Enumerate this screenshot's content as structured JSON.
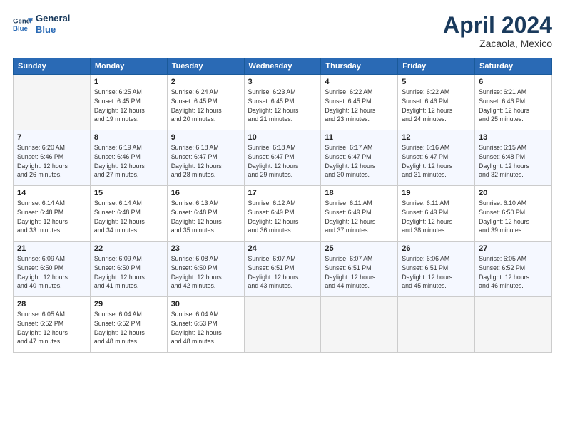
{
  "header": {
    "logo_line1": "General",
    "logo_line2": "Blue",
    "title": "April 2024",
    "subtitle": "Zacaola, Mexico"
  },
  "weekdays": [
    "Sunday",
    "Monday",
    "Tuesday",
    "Wednesday",
    "Thursday",
    "Friday",
    "Saturday"
  ],
  "weeks": [
    [
      {
        "num": "",
        "info": ""
      },
      {
        "num": "1",
        "info": "Sunrise: 6:25 AM\nSunset: 6:45 PM\nDaylight: 12 hours\nand 19 minutes."
      },
      {
        "num": "2",
        "info": "Sunrise: 6:24 AM\nSunset: 6:45 PM\nDaylight: 12 hours\nand 20 minutes."
      },
      {
        "num": "3",
        "info": "Sunrise: 6:23 AM\nSunset: 6:45 PM\nDaylight: 12 hours\nand 21 minutes."
      },
      {
        "num": "4",
        "info": "Sunrise: 6:22 AM\nSunset: 6:45 PM\nDaylight: 12 hours\nand 23 minutes."
      },
      {
        "num": "5",
        "info": "Sunrise: 6:22 AM\nSunset: 6:46 PM\nDaylight: 12 hours\nand 24 minutes."
      },
      {
        "num": "6",
        "info": "Sunrise: 6:21 AM\nSunset: 6:46 PM\nDaylight: 12 hours\nand 25 minutes."
      }
    ],
    [
      {
        "num": "7",
        "info": "Sunrise: 6:20 AM\nSunset: 6:46 PM\nDaylight: 12 hours\nand 26 minutes."
      },
      {
        "num": "8",
        "info": "Sunrise: 6:19 AM\nSunset: 6:46 PM\nDaylight: 12 hours\nand 27 minutes."
      },
      {
        "num": "9",
        "info": "Sunrise: 6:18 AM\nSunset: 6:47 PM\nDaylight: 12 hours\nand 28 minutes."
      },
      {
        "num": "10",
        "info": "Sunrise: 6:18 AM\nSunset: 6:47 PM\nDaylight: 12 hours\nand 29 minutes."
      },
      {
        "num": "11",
        "info": "Sunrise: 6:17 AM\nSunset: 6:47 PM\nDaylight: 12 hours\nand 30 minutes."
      },
      {
        "num": "12",
        "info": "Sunrise: 6:16 AM\nSunset: 6:47 PM\nDaylight: 12 hours\nand 31 minutes."
      },
      {
        "num": "13",
        "info": "Sunrise: 6:15 AM\nSunset: 6:48 PM\nDaylight: 12 hours\nand 32 minutes."
      }
    ],
    [
      {
        "num": "14",
        "info": "Sunrise: 6:14 AM\nSunset: 6:48 PM\nDaylight: 12 hours\nand 33 minutes."
      },
      {
        "num": "15",
        "info": "Sunrise: 6:14 AM\nSunset: 6:48 PM\nDaylight: 12 hours\nand 34 minutes."
      },
      {
        "num": "16",
        "info": "Sunrise: 6:13 AM\nSunset: 6:48 PM\nDaylight: 12 hours\nand 35 minutes."
      },
      {
        "num": "17",
        "info": "Sunrise: 6:12 AM\nSunset: 6:49 PM\nDaylight: 12 hours\nand 36 minutes."
      },
      {
        "num": "18",
        "info": "Sunrise: 6:11 AM\nSunset: 6:49 PM\nDaylight: 12 hours\nand 37 minutes."
      },
      {
        "num": "19",
        "info": "Sunrise: 6:11 AM\nSunset: 6:49 PM\nDaylight: 12 hours\nand 38 minutes."
      },
      {
        "num": "20",
        "info": "Sunrise: 6:10 AM\nSunset: 6:50 PM\nDaylight: 12 hours\nand 39 minutes."
      }
    ],
    [
      {
        "num": "21",
        "info": "Sunrise: 6:09 AM\nSunset: 6:50 PM\nDaylight: 12 hours\nand 40 minutes."
      },
      {
        "num": "22",
        "info": "Sunrise: 6:09 AM\nSunset: 6:50 PM\nDaylight: 12 hours\nand 41 minutes."
      },
      {
        "num": "23",
        "info": "Sunrise: 6:08 AM\nSunset: 6:50 PM\nDaylight: 12 hours\nand 42 minutes."
      },
      {
        "num": "24",
        "info": "Sunrise: 6:07 AM\nSunset: 6:51 PM\nDaylight: 12 hours\nand 43 minutes."
      },
      {
        "num": "25",
        "info": "Sunrise: 6:07 AM\nSunset: 6:51 PM\nDaylight: 12 hours\nand 44 minutes."
      },
      {
        "num": "26",
        "info": "Sunrise: 6:06 AM\nSunset: 6:51 PM\nDaylight: 12 hours\nand 45 minutes."
      },
      {
        "num": "27",
        "info": "Sunrise: 6:05 AM\nSunset: 6:52 PM\nDaylight: 12 hours\nand 46 minutes."
      }
    ],
    [
      {
        "num": "28",
        "info": "Sunrise: 6:05 AM\nSunset: 6:52 PM\nDaylight: 12 hours\nand 47 minutes."
      },
      {
        "num": "29",
        "info": "Sunrise: 6:04 AM\nSunset: 6:52 PM\nDaylight: 12 hours\nand 48 minutes."
      },
      {
        "num": "30",
        "info": "Sunrise: 6:04 AM\nSunset: 6:53 PM\nDaylight: 12 hours\nand 48 minutes."
      },
      {
        "num": "",
        "info": ""
      },
      {
        "num": "",
        "info": ""
      },
      {
        "num": "",
        "info": ""
      },
      {
        "num": "",
        "info": ""
      }
    ]
  ]
}
